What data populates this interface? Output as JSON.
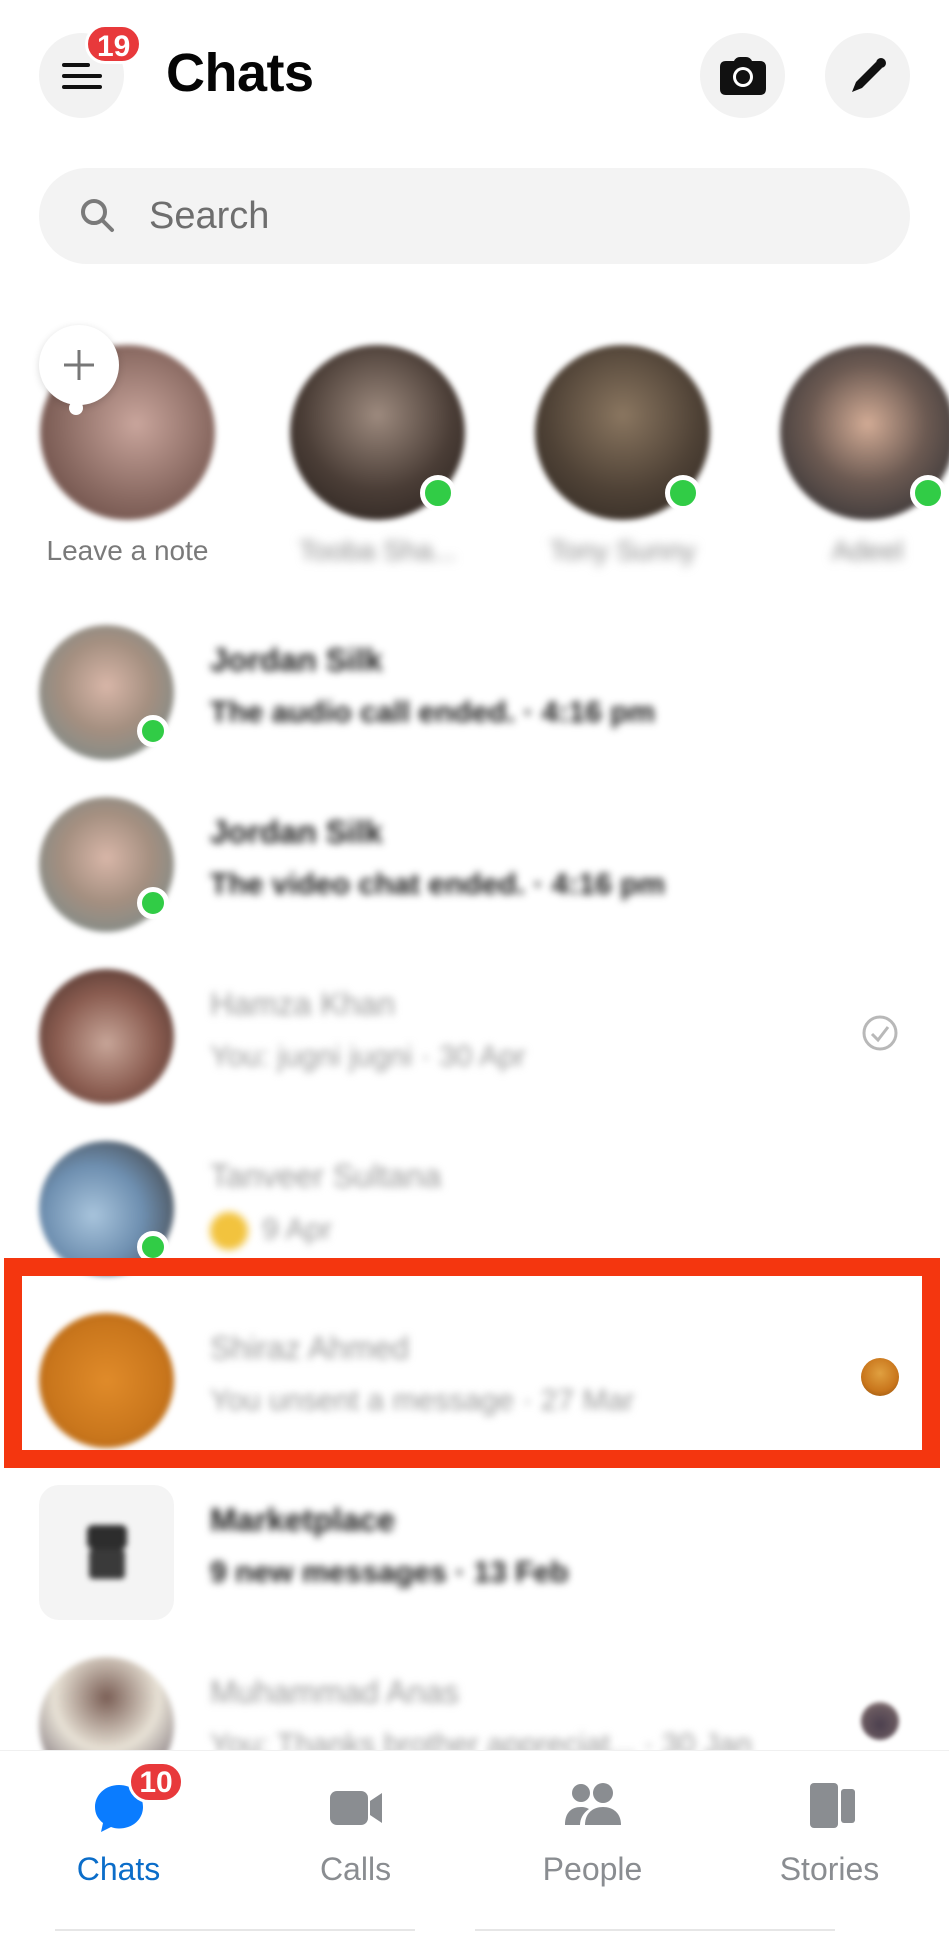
{
  "header": {
    "title": "Chats",
    "menu_badge": "19",
    "menu_icon": "hamburger-icon",
    "camera_icon": "camera-icon",
    "compose_icon": "pencil-icon"
  },
  "search": {
    "placeholder": "Search",
    "icon": "search-icon"
  },
  "notes": [
    {
      "label": "Leave a note",
      "online": false,
      "is_self": true,
      "colors": [
        "#7a5a55",
        "#c9a59c"
      ]
    },
    {
      "label": "Tooba Sha...",
      "online": true,
      "is_self": false,
      "colors": [
        "#5a4a42",
        "#2c2522"
      ]
    },
    {
      "label": "Tony Sunny",
      "online": true,
      "is_self": false,
      "colors": [
        "#6b5a3e",
        "#3a2f28"
      ]
    },
    {
      "label": "Adeel",
      "online": true,
      "is_self": false,
      "colors": [
        "#3b3a3e",
        "#c59a80"
      ]
    }
  ],
  "chats": [
    {
      "name": "Jordan Silk",
      "preview": "The audio call ended. · 4:16 pm",
      "unread": true,
      "online": true,
      "meta": "",
      "colors": [
        "#b9a593",
        "#6f8a8d"
      ]
    },
    {
      "name": "Jordan Silk",
      "preview": "The video chat ended. · 4:16 pm",
      "unread": true,
      "online": true,
      "meta": "",
      "colors": [
        "#b9a593",
        "#6f8a8d"
      ]
    },
    {
      "name": "Hamza Khan",
      "preview": "You: jugni jugni · 30 Apr",
      "unread": false,
      "online": false,
      "meta": "sent-check-icon",
      "colors": [
        "#5b3b33",
        "#c7a598"
      ]
    },
    {
      "name": "Tanveer Sultana",
      "preview": "9 Apr",
      "unread": false,
      "online": true,
      "meta": "",
      "emoji": true,
      "colors": [
        "#6e8fb0",
        "#4d4440"
      ]
    },
    {
      "name": "Shiraz Ahmed",
      "preview": "You unsent a message · 27 Mar",
      "unread": false,
      "online": false,
      "meta": "seen-avatar-icon",
      "colors": [
        "#c9761c",
        "#e08b2a"
      ]
    },
    {
      "name": "Marketplace",
      "preview": "9 new messages · 13 Feb",
      "unread": true,
      "online": false,
      "meta": "",
      "square": true,
      "colors": [
        "#f4f4f4",
        "#f4f4f4"
      ]
    },
    {
      "name": "Muhammad Anas",
      "preview": "You: Thanks brother appreciat... · 30 Jan",
      "unread": false,
      "online": false,
      "meta": "seen-avatar-icon",
      "colors": [
        "#e8e2d6",
        "#4b3f4e"
      ]
    }
  ],
  "highlighted_chat_index": 4,
  "bottom_nav": {
    "active": "Chats",
    "items": [
      {
        "label": "Chats",
        "icon": "chat-bubble-icon",
        "badge": "10"
      },
      {
        "label": "Calls",
        "icon": "video-camera-icon",
        "badge": ""
      },
      {
        "label": "People",
        "icon": "people-icon",
        "badge": ""
      },
      {
        "label": "Stories",
        "icon": "stories-icon",
        "badge": ""
      }
    ]
  },
  "colors": {
    "accent": "#0a7cff",
    "active_label": "#0b6dc9",
    "badge": "#e8393b",
    "online": "#31cc46",
    "highlight": "#f4360f",
    "inactive_icon": "#8a8d91"
  }
}
